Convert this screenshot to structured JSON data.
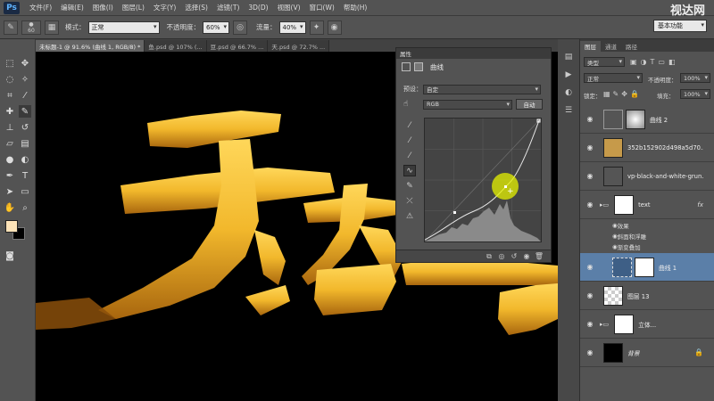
{
  "app": {
    "logo": "Ps",
    "brand": "视达网"
  },
  "menu": [
    "文件(F)",
    "编辑(E)",
    "图像(I)",
    "图层(L)",
    "文字(Y)",
    "选择(S)",
    "滤镜(T)",
    "3D(D)",
    "视图(V)",
    "窗口(W)",
    "帮助(H)"
  ],
  "options": {
    "brush_size": "60",
    "mode_label": "模式：",
    "mode_value": "正常",
    "opacity_label": "不透明度：",
    "opacity_value": "60%",
    "flow_label": "流量：",
    "flow_value": "40%",
    "workspace": "基本功能"
  },
  "tabs": [
    "未标题-1 @ 91.6% (曲线 1, RGB/8) *",
    "鱼.psd @ 107% (...",
    "豆.psd @ 66.7% ...",
    "天.psd @ 72.7% ..."
  ],
  "curves": {
    "panel_tab": "属性",
    "title": "曲线",
    "preset_label": "预设：",
    "preset_value": "自定",
    "channel": "RGB",
    "auto_button": "自动"
  },
  "layers_panel": {
    "tabs": [
      "图层",
      "通道",
      "路径"
    ],
    "filter": "类型",
    "blend_mode": "正常",
    "opacity_label": "不透明度：",
    "opacity_value": "100%",
    "lock_label": "锁定：",
    "fill_label": "填充：",
    "fill_value": "100%",
    "layers": [
      {
        "name": "曲线 2"
      },
      {
        "name": "352b152902d498a5d70..."
      },
      {
        "name": "vp-black-and-white-grun..."
      },
      {
        "name": "text",
        "fx": "fx"
      },
      {
        "name": "曲线 1"
      },
      {
        "name": "图层 13"
      },
      {
        "name": "立体..."
      },
      {
        "name": "背景"
      }
    ],
    "effects": {
      "label": "效果",
      "items": [
        "斜面和浮雕",
        "渐变叠加"
      ]
    }
  },
  "colors": {
    "gold": "#f2b82c",
    "selection": "#5b7fa8",
    "highlight": "#e6f200"
  }
}
